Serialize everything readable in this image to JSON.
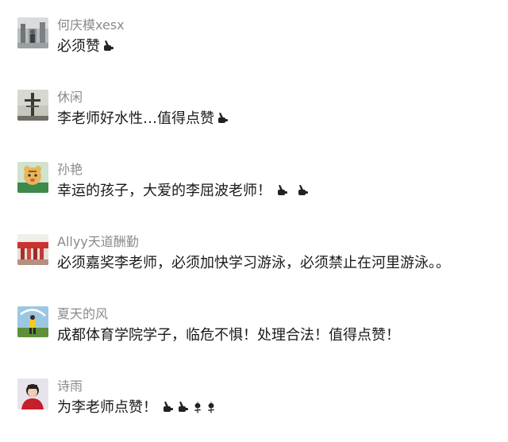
{
  "comments": [
    {
      "name": "何庆模xesx",
      "text": "必须赞",
      "emojis": [
        "thumbs-up"
      ]
    },
    {
      "name": "休闲",
      "text": "李老师好水性…值得点赞",
      "emojis": [
        "thumbs-up"
      ]
    },
    {
      "name": "孙艳",
      "text": "幸运的孩子，大爱的李屈波老师！",
      "emojis": [
        "thumbs-up",
        "thumbs-up"
      ]
    },
    {
      "name": "Allyy天道酬勤",
      "text": "必须嘉奖李老师，必须加快学习游泳，必须禁止在河里游泳。。",
      "emojis": []
    },
    {
      "name": "夏天的风",
      "text": "成都体育学院学子，临危不惧！处理合法！值得点赞！",
      "emojis": []
    },
    {
      "name": "诗雨",
      "text": "为李老师点赞！",
      "emojis": [
        "thumbs-up",
        "thumbs-up",
        "rose",
        "rose"
      ]
    }
  ]
}
